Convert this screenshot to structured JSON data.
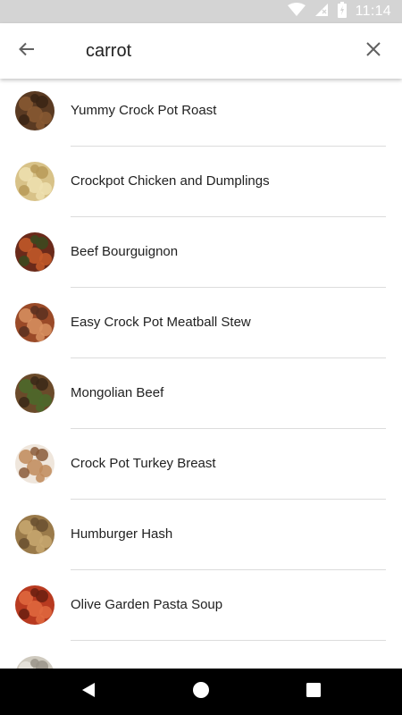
{
  "status_bar": {
    "time": "11:14",
    "icons": [
      "wifi-icon",
      "signal-icon",
      "battery-icon"
    ]
  },
  "search": {
    "query": "carrot",
    "back_icon": "arrow-left-icon",
    "clear_icon": "close-icon"
  },
  "results": [
    {
      "title": "Yummy Crock Pot Roast",
      "thumb_colors": [
        "#5a3a22",
        "#8a5a32",
        "#3a2414"
      ]
    },
    {
      "title": "Crockpot Chicken and Dumplings",
      "thumb_colors": [
        "#d8c288",
        "#efe0b0",
        "#b89a58"
      ]
    },
    {
      "title": "Beef Bourguignon",
      "thumb_colors": [
        "#6a2a1a",
        "#c45a2a",
        "#3a4a20"
      ]
    },
    {
      "title": "Easy Crock Pot Meatball Stew",
      "thumb_colors": [
        "#9a4a28",
        "#d89060",
        "#5a3020"
      ]
    },
    {
      "title": "Mongolian Beef",
      "thumb_colors": [
        "#6a4a2a",
        "#4a6a2a",
        "#3a2818"
      ]
    },
    {
      "title": "Crock Pot Turkey Breast",
      "thumb_colors": [
        "#efe6dc",
        "#c08a5a",
        "#8a5a3a"
      ]
    },
    {
      "title": "Humburger Hash",
      "thumb_colors": [
        "#9a7a4a",
        "#c8a870",
        "#6a5030"
      ]
    },
    {
      "title": "Olive Garden Pasta Soup",
      "thumb_colors": [
        "#b83a20",
        "#e06a40",
        "#6a2010"
      ]
    },
    {
      "title": "",
      "thumb_colors": [
        "#cfcabf",
        "#e8e4dc",
        "#9a9488"
      ]
    }
  ],
  "nav_bar": {
    "back": "triangle-back-icon",
    "home": "circle-home-icon",
    "recents": "square-recents-icon"
  }
}
